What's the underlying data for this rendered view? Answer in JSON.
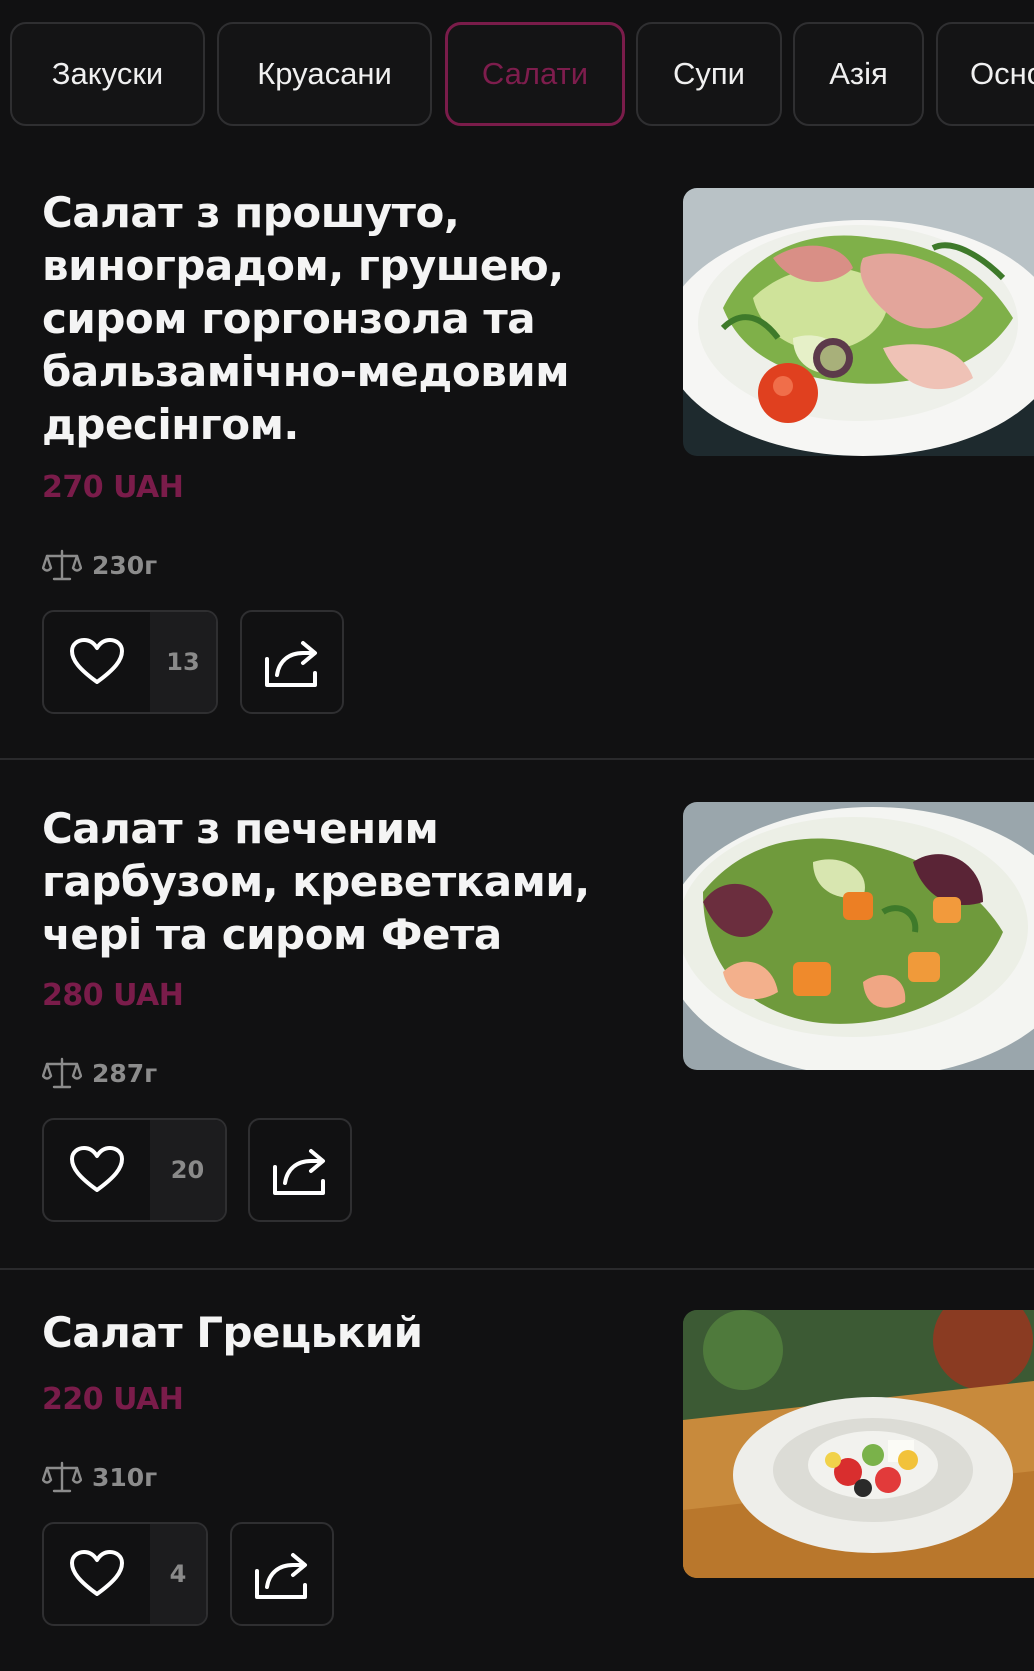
{
  "tabs": [
    {
      "label": "Закуски"
    },
    {
      "label": "Круасани"
    },
    {
      "label": "Салати"
    },
    {
      "label": "Супи"
    },
    {
      "label": "Азія"
    },
    {
      "label": "Осно"
    }
  ],
  "active_tab": "Салати",
  "items": [
    {
      "title": "Салат з прошуто, виноградом, грушею, сиром горгонзола та бальзамічно-медовим дресінгом.",
      "price": "270 UAH",
      "weight": "230г",
      "likes": "13",
      "image": "prosciutto-salad-photo"
    },
    {
      "title": "Салат з печеним гарбузом, креветками, чері та сиром Фета",
      "price": "280 UAH",
      "weight": "287г",
      "likes": "20",
      "image": "pumpkin-shrimp-salad-photo"
    },
    {
      "title": "Салат Грецький",
      "price": "220 UAH",
      "weight": "310г",
      "likes": "4",
      "image": "greek-salad-photo"
    }
  ],
  "colors": {
    "background": "#111112",
    "accent": "#7a1c4a",
    "border": "#2f2f31",
    "muted_text": "#8c8c8c"
  },
  "icons": {
    "weight": "scale-icon",
    "like": "heart-icon",
    "share": "share-icon"
  }
}
